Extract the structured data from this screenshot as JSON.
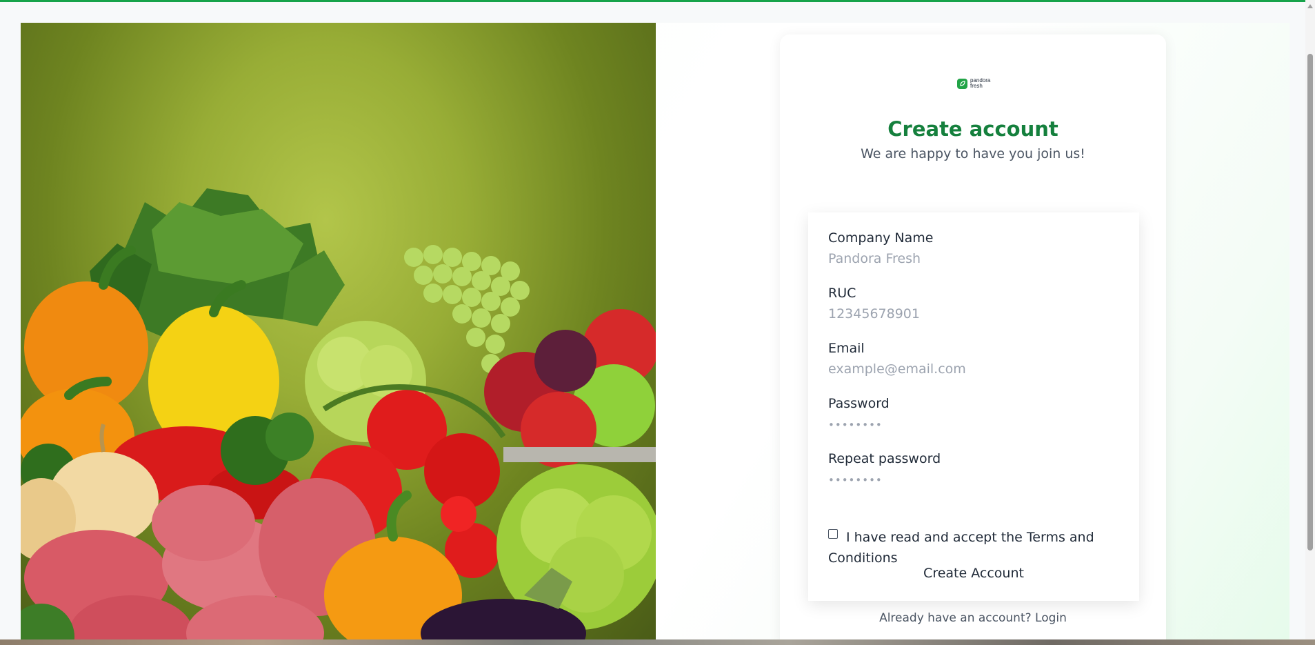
{
  "brand": {
    "logo_line1": "pandora",
    "logo_line2": "fresh",
    "accent_color": "#16a34a"
  },
  "hero_image": {
    "subject": "fresh-vegetables-and-fruits"
  },
  "signup": {
    "title": "Create account",
    "subtitle": "We are happy to have you join us!",
    "fields": [
      {
        "label": "Company Name",
        "placeholder": "Pandora Fresh",
        "type": "text"
      },
      {
        "label": "RUC",
        "placeholder": "12345678901",
        "type": "text"
      },
      {
        "label": "Email",
        "placeholder": "example@email.com",
        "type": "email"
      },
      {
        "label": "Password",
        "placeholder": "••••••••",
        "type": "password"
      },
      {
        "label": "Repeat password",
        "placeholder": "••••••••",
        "type": "password"
      }
    ],
    "terms_label": "I have read and accept the Terms and Conditions",
    "terms_checked": false,
    "submit_label": "Create Account",
    "login_prompt": "Already have an account?",
    "login_link": "Login"
  }
}
